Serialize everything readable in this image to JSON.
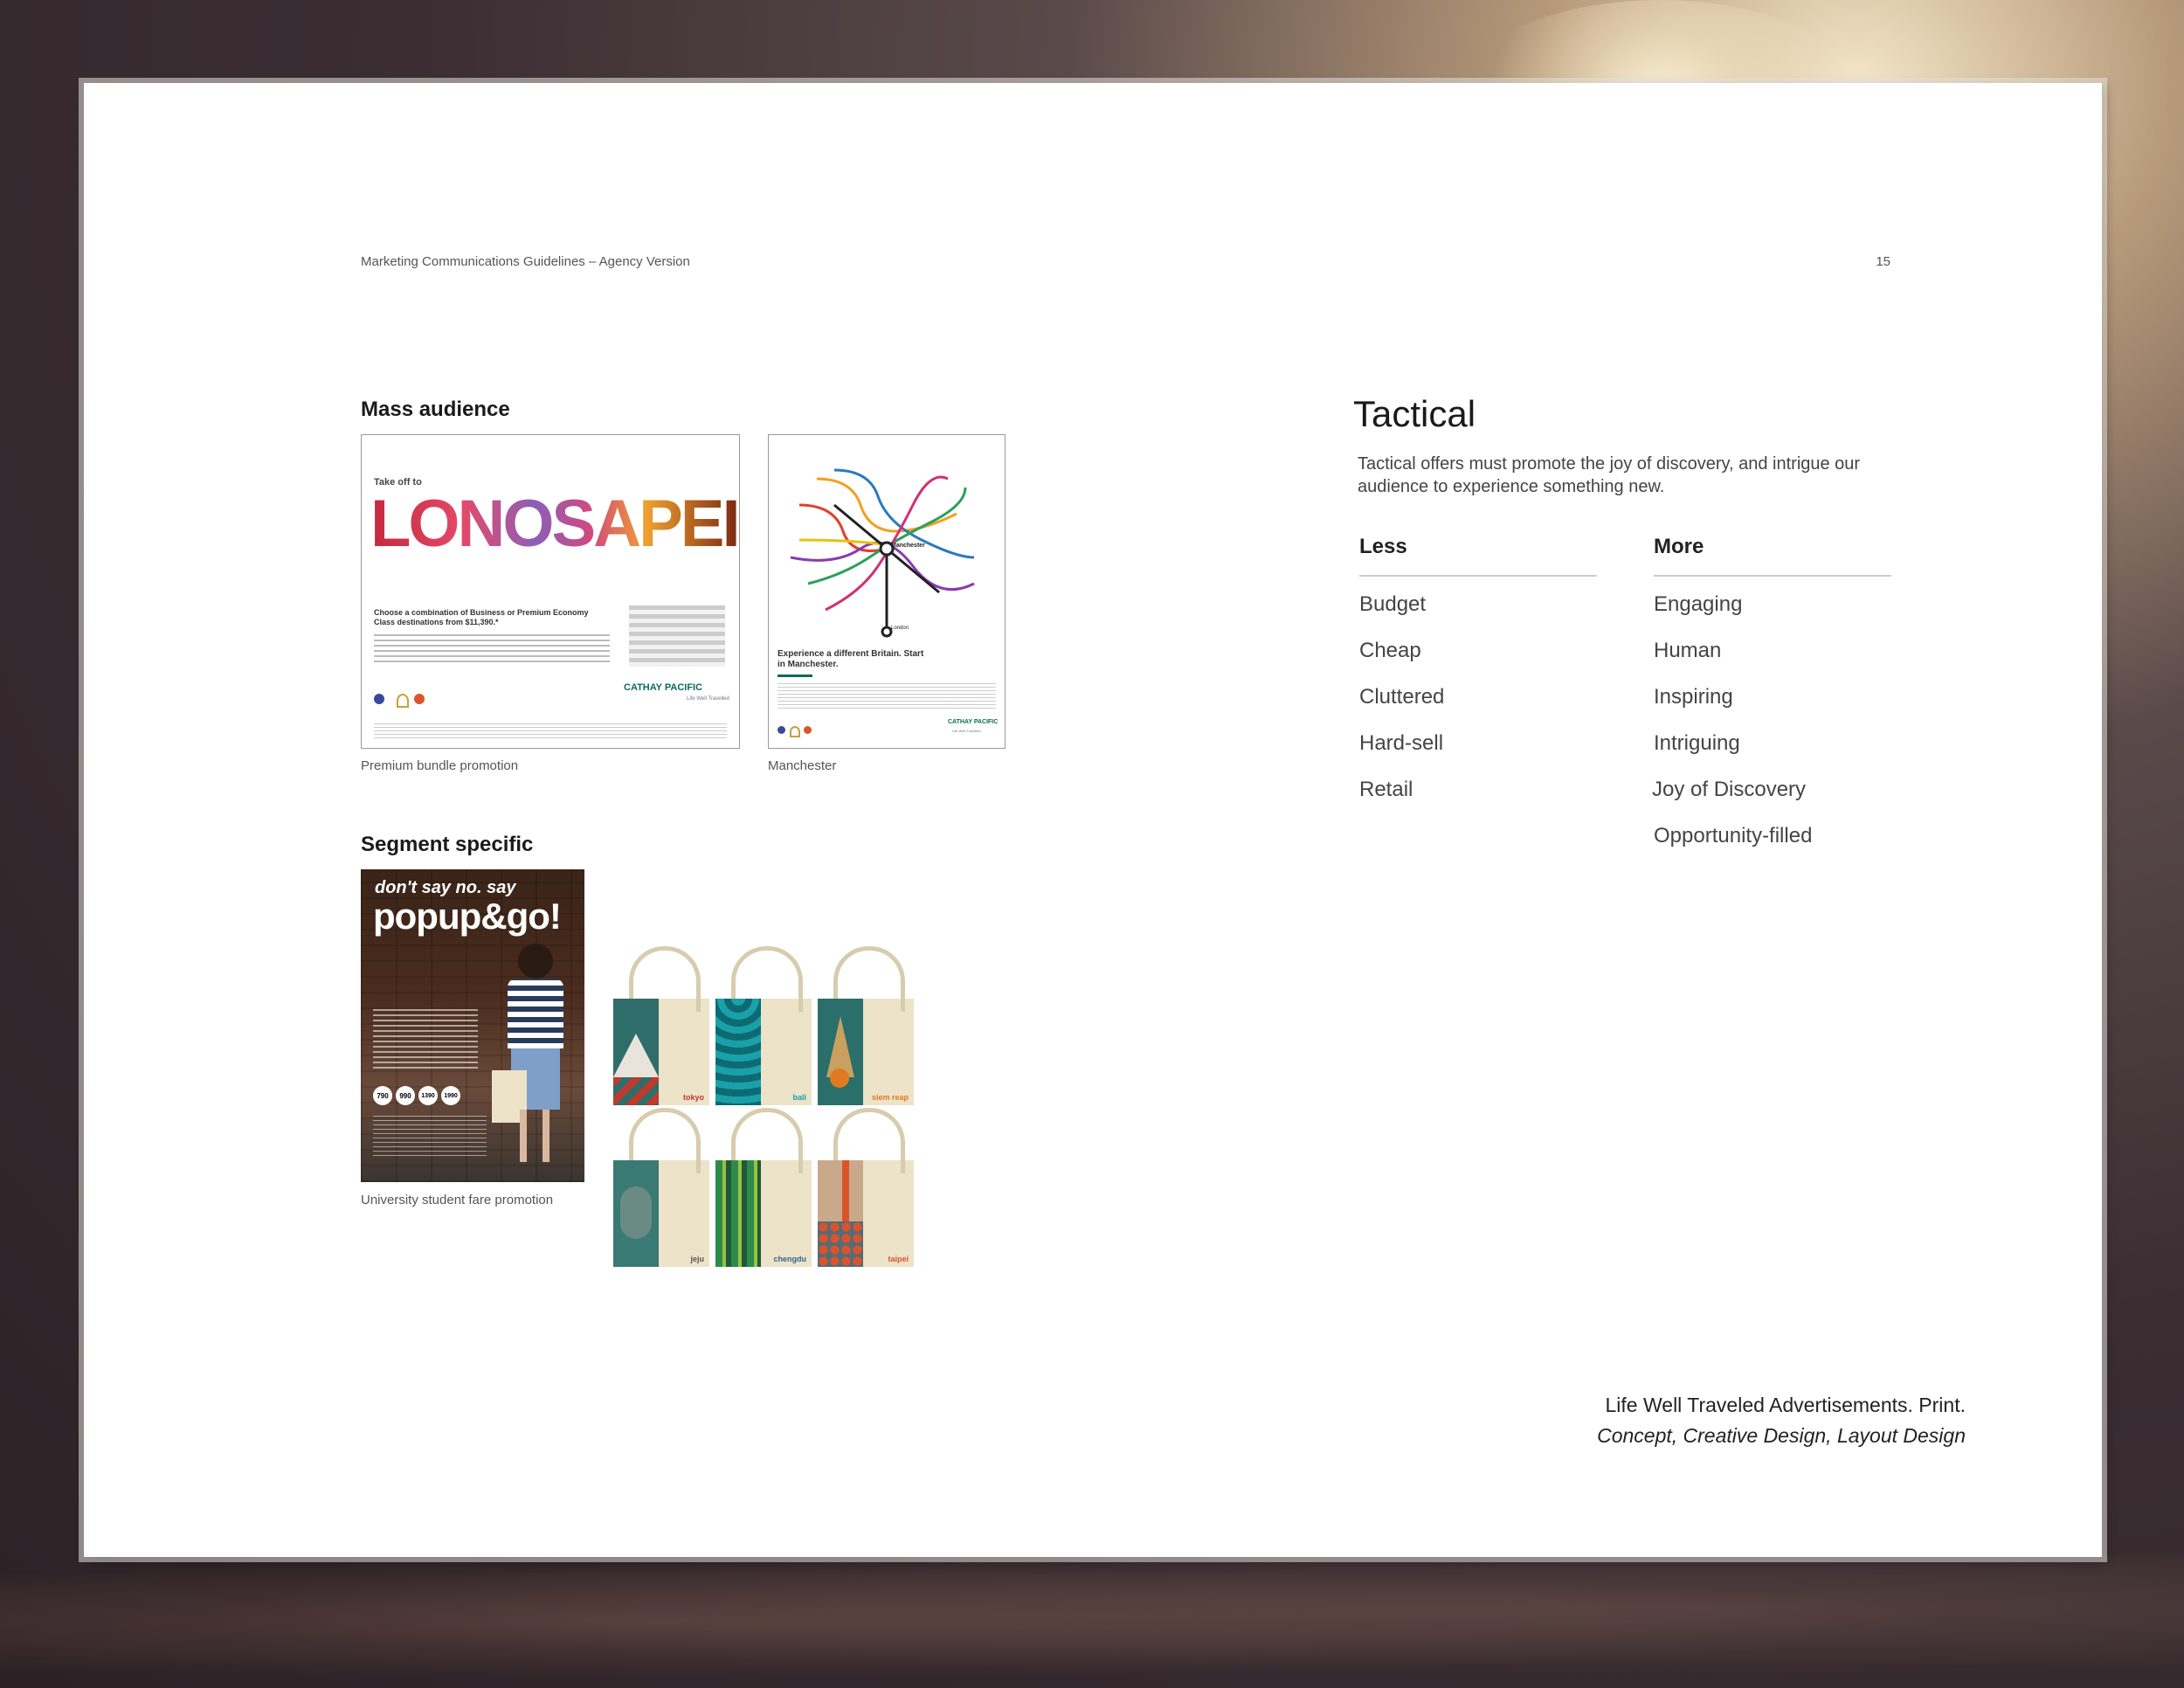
{
  "header": {
    "doc_title": "Marketing Communications Guidelines – Agency Version",
    "page_number": "15"
  },
  "mass_audience": {
    "title": "Mass audience",
    "items": [
      {
        "caption": "Premium bundle promotion",
        "headline_small": "Take off to",
        "headline_big": "LONOSAPEI",
        "body_head": "Choose a combination of Business or Premium Economy Class destinations from $11,390.*",
        "brand": "CATHAY PACIFIC",
        "tagline": "Life Well Travelled"
      },
      {
        "caption": "Manchester",
        "station_main": "Manchester",
        "station_end": "London",
        "body_head": "Experience a different Britain. Start in Manchester.",
        "brand": "CATHAY PACIFIC",
        "tagline": "Life Well Travelled"
      }
    ]
  },
  "segment_specific": {
    "title": "Segment specific",
    "poster": {
      "caption": "University student fare promotion",
      "line1": "don't say no. say",
      "line2": "popup&go!",
      "prices": [
        "790",
        "990",
        "1390",
        "1990"
      ]
    },
    "totes": [
      {
        "label": "tokyo",
        "color": "#2f6d6a",
        "accent": "#c0392b"
      },
      {
        "label": "bali",
        "color": "#1aa0a8",
        "accent": "#1aa0a8"
      },
      {
        "label": "siem reap",
        "color": "#2a6f6a",
        "accent": "#e07a1f"
      },
      {
        "label": "jeju",
        "color": "#3a7a74",
        "accent": "#555"
      },
      {
        "label": "chengdu",
        "color": "#2e8a4a",
        "accent": "#2e6a8a"
      },
      {
        "label": "taipei",
        "color": "#c9a98a",
        "accent": "#d9542c"
      }
    ]
  },
  "tactical": {
    "title": "Tactical",
    "description": "Tactical offers must promote the joy of discovery, and intrigue our audience to experience something new.",
    "less_heading": "Less",
    "more_heading": "More",
    "less": [
      "Budget",
      "Cheap",
      "Cluttered",
      "Hard-sell",
      "Retail"
    ],
    "more": [
      "Engaging",
      "Human",
      "Inspiring",
      "Intriguing",
      "Joy of Discovery",
      "Opportunity-filled"
    ]
  },
  "credits": {
    "line1": "Life Well Traveled Advertisements. Print.",
    "line2": "Concept, Creative Design, Layout Design"
  }
}
